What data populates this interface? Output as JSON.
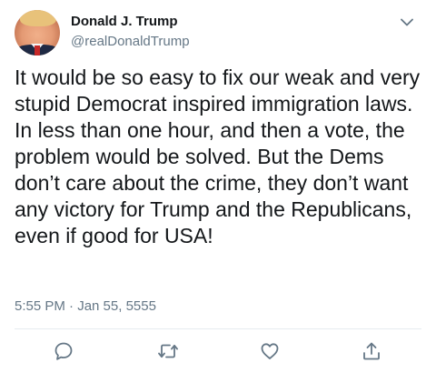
{
  "author": {
    "display_name": "Donald J. Trump",
    "handle": "@realDonaldTrump"
  },
  "tweet": {
    "text": "It would be so easy to fix our weak and very stupid Democrat inspired immigration laws. In less than one hour, and then a vote, the problem would be solved. But the Dems don’t care about the crime, they don’t want any victory for Trump and the Republicans, even if good for USA!",
    "timestamp": "5:55 PM · Jan 55, 5555"
  },
  "icons": {
    "menu": "chevron-down-icon",
    "reply": "reply-icon",
    "retweet": "retweet-icon",
    "like": "heart-icon",
    "share": "share-icon"
  },
  "colors": {
    "text": "#14171a",
    "secondary": "#657786",
    "icon": "#657786",
    "divider": "#e6ecf0"
  }
}
